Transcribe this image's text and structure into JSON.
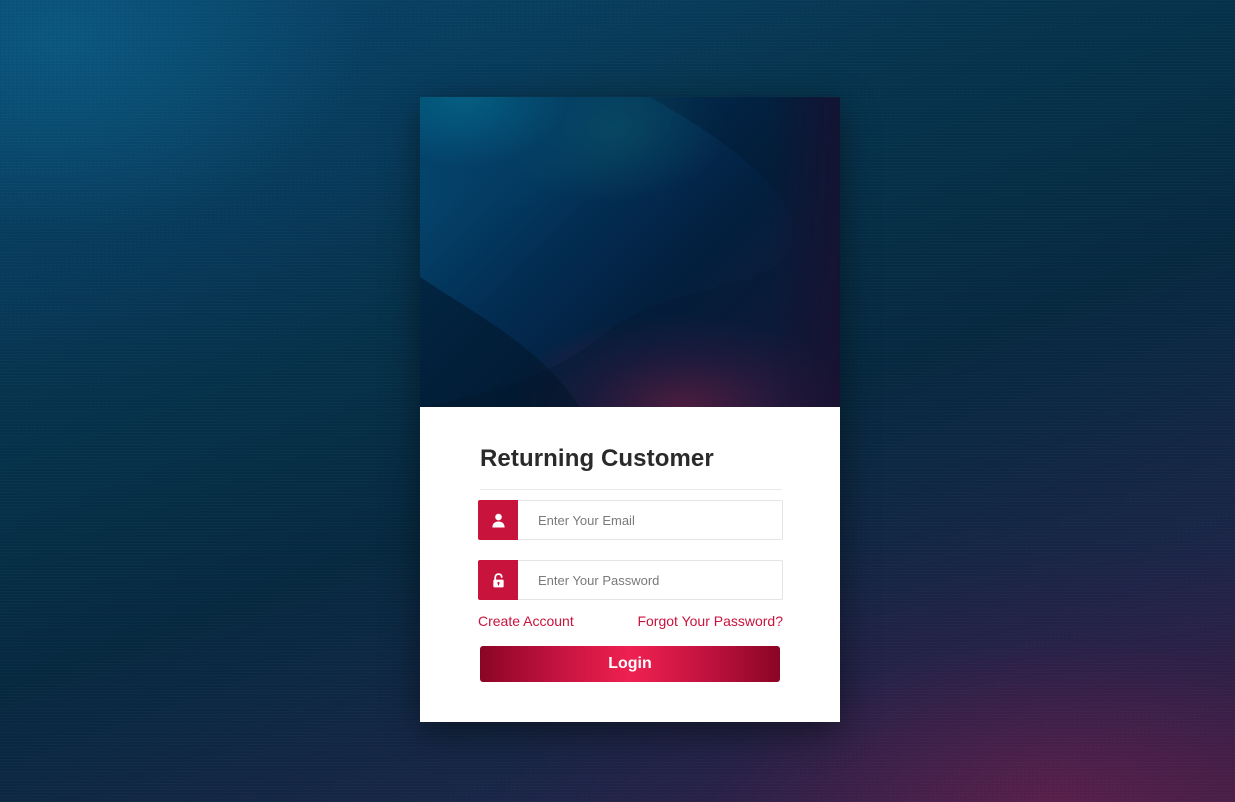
{
  "login_card": {
    "title": "Returning Customer",
    "email": {
      "icon": "user-icon",
      "placeholder": "Enter Your Email",
      "value": ""
    },
    "password": {
      "icon": "unlock-icon",
      "placeholder": "Enter Your Password",
      "value": ""
    },
    "create_account_label": "Create Account",
    "forgot_password_label": "Forgot Your Password?",
    "login_label": "Login"
  },
  "colors": {
    "accent": "#c8133d",
    "button_gradient": [
      "#8a0524",
      "#ef2151",
      "#8a0524"
    ],
    "title_text": "#2a2a2a",
    "background": "#062940"
  }
}
